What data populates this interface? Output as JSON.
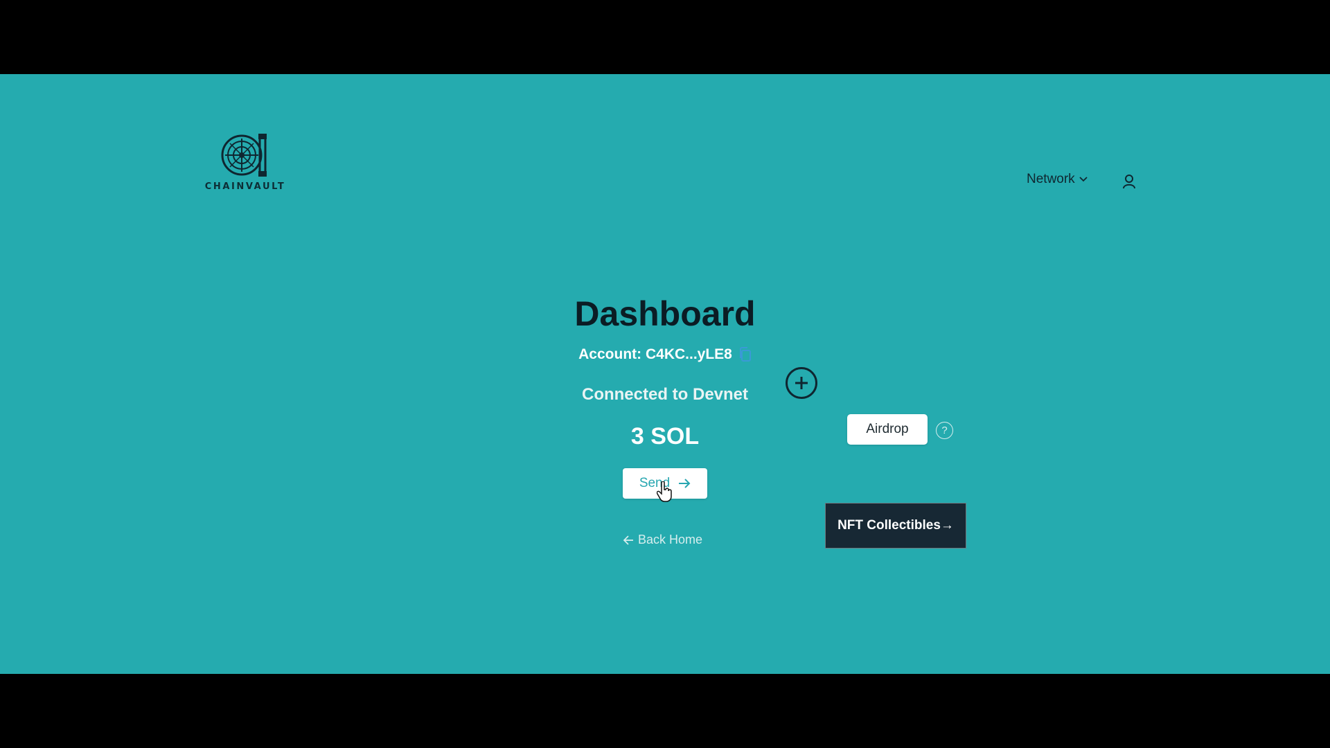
{
  "brand": {
    "name": "CHAINVAULT"
  },
  "header": {
    "network_label": "Network"
  },
  "main": {
    "title": "Dashboard",
    "account_label": "Account: C4KC...yLE8",
    "network_status": "Connected to Devnet",
    "balance": "3 SOL",
    "send_label": "Send",
    "back_home_label": "Back Home"
  },
  "actions": {
    "airdrop_label": "Airdrop",
    "help_symbol": "?",
    "nft_label": "NFT Collectibles→"
  },
  "icons": [
    "vault-logo-icon",
    "chevron-down-icon",
    "user-icon",
    "copy-icon",
    "arrow-right-icon",
    "arrow-left-icon",
    "plus-circle-icon",
    "help-icon",
    "pointer-cursor-icon"
  ],
  "colors": {
    "background": "#25abaf",
    "dark": "#172834",
    "accent_text": "#27a6b0"
  }
}
